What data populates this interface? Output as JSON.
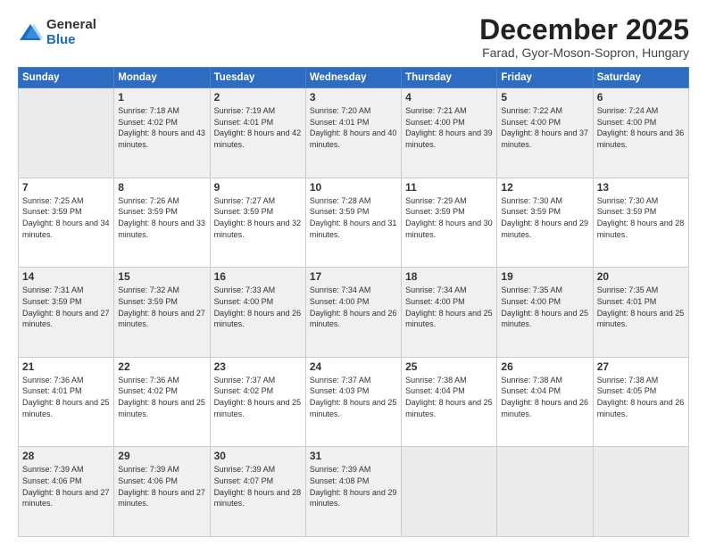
{
  "logo": {
    "general": "General",
    "blue": "Blue"
  },
  "header": {
    "month": "December 2025",
    "location": "Farad, Gyor-Moson-Sopron, Hungary"
  },
  "weekdays": [
    "Sunday",
    "Monday",
    "Tuesday",
    "Wednesday",
    "Thursday",
    "Friday",
    "Saturday"
  ],
  "weeks": [
    [
      {
        "day": null
      },
      {
        "day": 1,
        "sunrise": "7:18 AM",
        "sunset": "4:02 PM",
        "daylight": "8 hours and 43 minutes."
      },
      {
        "day": 2,
        "sunrise": "7:19 AM",
        "sunset": "4:01 PM",
        "daylight": "8 hours and 42 minutes."
      },
      {
        "day": 3,
        "sunrise": "7:20 AM",
        "sunset": "4:01 PM",
        "daylight": "8 hours and 40 minutes."
      },
      {
        "day": 4,
        "sunrise": "7:21 AM",
        "sunset": "4:00 PM",
        "daylight": "8 hours and 39 minutes."
      },
      {
        "day": 5,
        "sunrise": "7:22 AM",
        "sunset": "4:00 PM",
        "daylight": "8 hours and 37 minutes."
      },
      {
        "day": 6,
        "sunrise": "7:24 AM",
        "sunset": "4:00 PM",
        "daylight": "8 hours and 36 minutes."
      }
    ],
    [
      {
        "day": 7,
        "sunrise": "7:25 AM",
        "sunset": "3:59 PM",
        "daylight": "8 hours and 34 minutes."
      },
      {
        "day": 8,
        "sunrise": "7:26 AM",
        "sunset": "3:59 PM",
        "daylight": "8 hours and 33 minutes."
      },
      {
        "day": 9,
        "sunrise": "7:27 AM",
        "sunset": "3:59 PM",
        "daylight": "8 hours and 32 minutes."
      },
      {
        "day": 10,
        "sunrise": "7:28 AM",
        "sunset": "3:59 PM",
        "daylight": "8 hours and 31 minutes."
      },
      {
        "day": 11,
        "sunrise": "7:29 AM",
        "sunset": "3:59 PM",
        "daylight": "8 hours and 30 minutes."
      },
      {
        "day": 12,
        "sunrise": "7:30 AM",
        "sunset": "3:59 PM",
        "daylight": "8 hours and 29 minutes."
      },
      {
        "day": 13,
        "sunrise": "7:30 AM",
        "sunset": "3:59 PM",
        "daylight": "8 hours and 28 minutes."
      }
    ],
    [
      {
        "day": 14,
        "sunrise": "7:31 AM",
        "sunset": "3:59 PM",
        "daylight": "8 hours and 27 minutes."
      },
      {
        "day": 15,
        "sunrise": "7:32 AM",
        "sunset": "3:59 PM",
        "daylight": "8 hours and 27 minutes."
      },
      {
        "day": 16,
        "sunrise": "7:33 AM",
        "sunset": "4:00 PM",
        "daylight": "8 hours and 26 minutes."
      },
      {
        "day": 17,
        "sunrise": "7:34 AM",
        "sunset": "4:00 PM",
        "daylight": "8 hours and 26 minutes."
      },
      {
        "day": 18,
        "sunrise": "7:34 AM",
        "sunset": "4:00 PM",
        "daylight": "8 hours and 25 minutes."
      },
      {
        "day": 19,
        "sunrise": "7:35 AM",
        "sunset": "4:00 PM",
        "daylight": "8 hours and 25 minutes."
      },
      {
        "day": 20,
        "sunrise": "7:35 AM",
        "sunset": "4:01 PM",
        "daylight": "8 hours and 25 minutes."
      }
    ],
    [
      {
        "day": 21,
        "sunrise": "7:36 AM",
        "sunset": "4:01 PM",
        "daylight": "8 hours and 25 minutes."
      },
      {
        "day": 22,
        "sunrise": "7:36 AM",
        "sunset": "4:02 PM",
        "daylight": "8 hours and 25 minutes."
      },
      {
        "day": 23,
        "sunrise": "7:37 AM",
        "sunset": "4:02 PM",
        "daylight": "8 hours and 25 minutes."
      },
      {
        "day": 24,
        "sunrise": "7:37 AM",
        "sunset": "4:03 PM",
        "daylight": "8 hours and 25 minutes."
      },
      {
        "day": 25,
        "sunrise": "7:38 AM",
        "sunset": "4:04 PM",
        "daylight": "8 hours and 25 minutes."
      },
      {
        "day": 26,
        "sunrise": "7:38 AM",
        "sunset": "4:04 PM",
        "daylight": "8 hours and 26 minutes."
      },
      {
        "day": 27,
        "sunrise": "7:38 AM",
        "sunset": "4:05 PM",
        "daylight": "8 hours and 26 minutes."
      }
    ],
    [
      {
        "day": 28,
        "sunrise": "7:39 AM",
        "sunset": "4:06 PM",
        "daylight": "8 hours and 27 minutes."
      },
      {
        "day": 29,
        "sunrise": "7:39 AM",
        "sunset": "4:06 PM",
        "daylight": "8 hours and 27 minutes."
      },
      {
        "day": 30,
        "sunrise": "7:39 AM",
        "sunset": "4:07 PM",
        "daylight": "8 hours and 28 minutes."
      },
      {
        "day": 31,
        "sunrise": "7:39 AM",
        "sunset": "4:08 PM",
        "daylight": "8 hours and 29 minutes."
      },
      {
        "day": null
      },
      {
        "day": null
      },
      {
        "day": null
      }
    ]
  ]
}
